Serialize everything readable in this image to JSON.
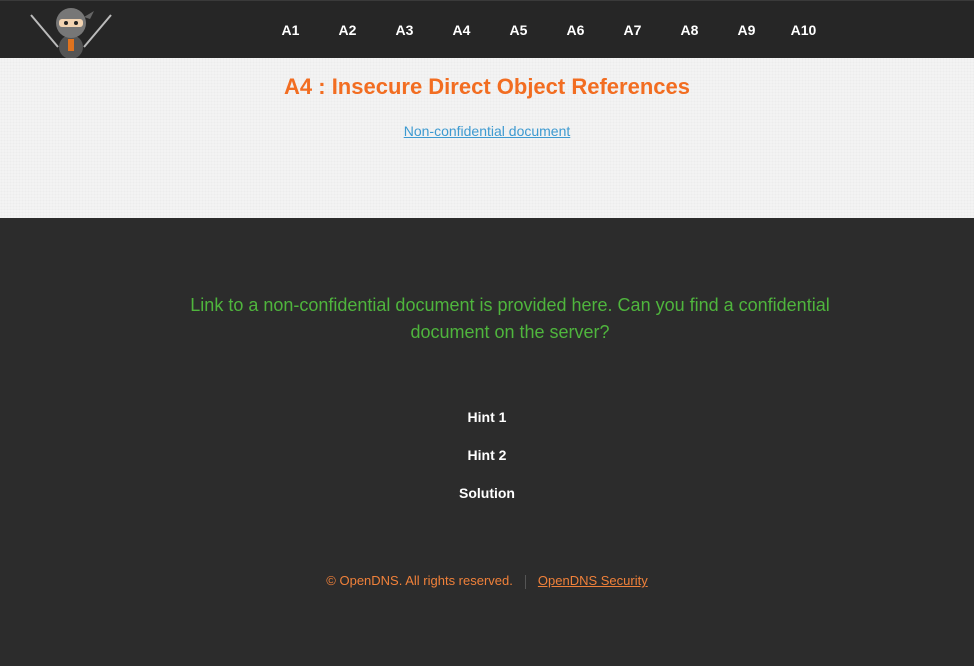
{
  "nav": {
    "items": [
      {
        "label": "A1"
      },
      {
        "label": "A2"
      },
      {
        "label": "A3"
      },
      {
        "label": "A4"
      },
      {
        "label": "A5"
      },
      {
        "label": "A6"
      },
      {
        "label": "A7"
      },
      {
        "label": "A8"
      },
      {
        "label": "A9"
      },
      {
        "label": "A10"
      }
    ]
  },
  "hero": {
    "title": "A4 : Insecure Direct Object References",
    "link_text": "Non-confidential document"
  },
  "main": {
    "description": "Link to a non-confidential document is provided here. Can you find a confidential document on the server?",
    "hint1": "Hint 1",
    "hint2": "Hint 2",
    "solution": "Solution"
  },
  "footer": {
    "copyright": "© OpenDNS. All rights reserved.",
    "link": "OpenDNS Security"
  },
  "colors": {
    "accent_orange": "#f26d21",
    "link_blue": "#3d9ad1",
    "green_text": "#4fb53d",
    "dark_bg": "#2c2c2c"
  },
  "icons": {
    "logo": "ninja-logo-icon"
  }
}
